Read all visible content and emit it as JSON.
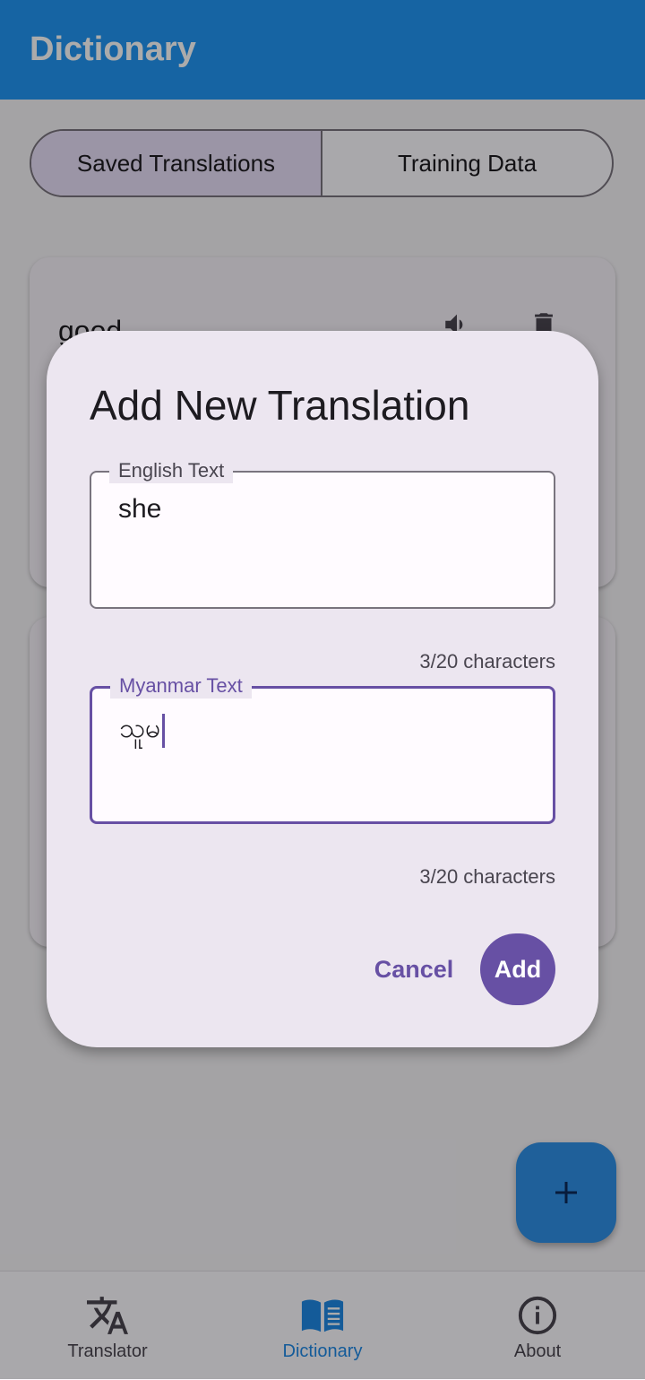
{
  "app_bar": {
    "title": "Dictionary"
  },
  "tabs": [
    {
      "label": "Saved Translations",
      "active": true
    },
    {
      "label": "Training Data",
      "active": false
    }
  ],
  "cards": [
    {
      "word": "good"
    }
  ],
  "dialog": {
    "title": "Add New Translation",
    "english": {
      "label": "English Text",
      "value": "she",
      "counter": "3/20 characters"
    },
    "myanmar": {
      "label": "Myanmar Text",
      "value": "သူမ",
      "counter": "3/20 characters"
    },
    "cancel_label": "Cancel",
    "add_label": "Add"
  },
  "bottom_nav": [
    {
      "label": "Translator",
      "icon": "translate-icon",
      "active": false
    },
    {
      "label": "Dictionary",
      "icon": "book-icon",
      "active": true
    },
    {
      "label": "About",
      "icon": "info-icon",
      "active": false
    }
  ],
  "colors": {
    "primary_blue": "#2196f3",
    "accent_purple": "#6750a4",
    "dialog_bg": "#ece6f0"
  }
}
